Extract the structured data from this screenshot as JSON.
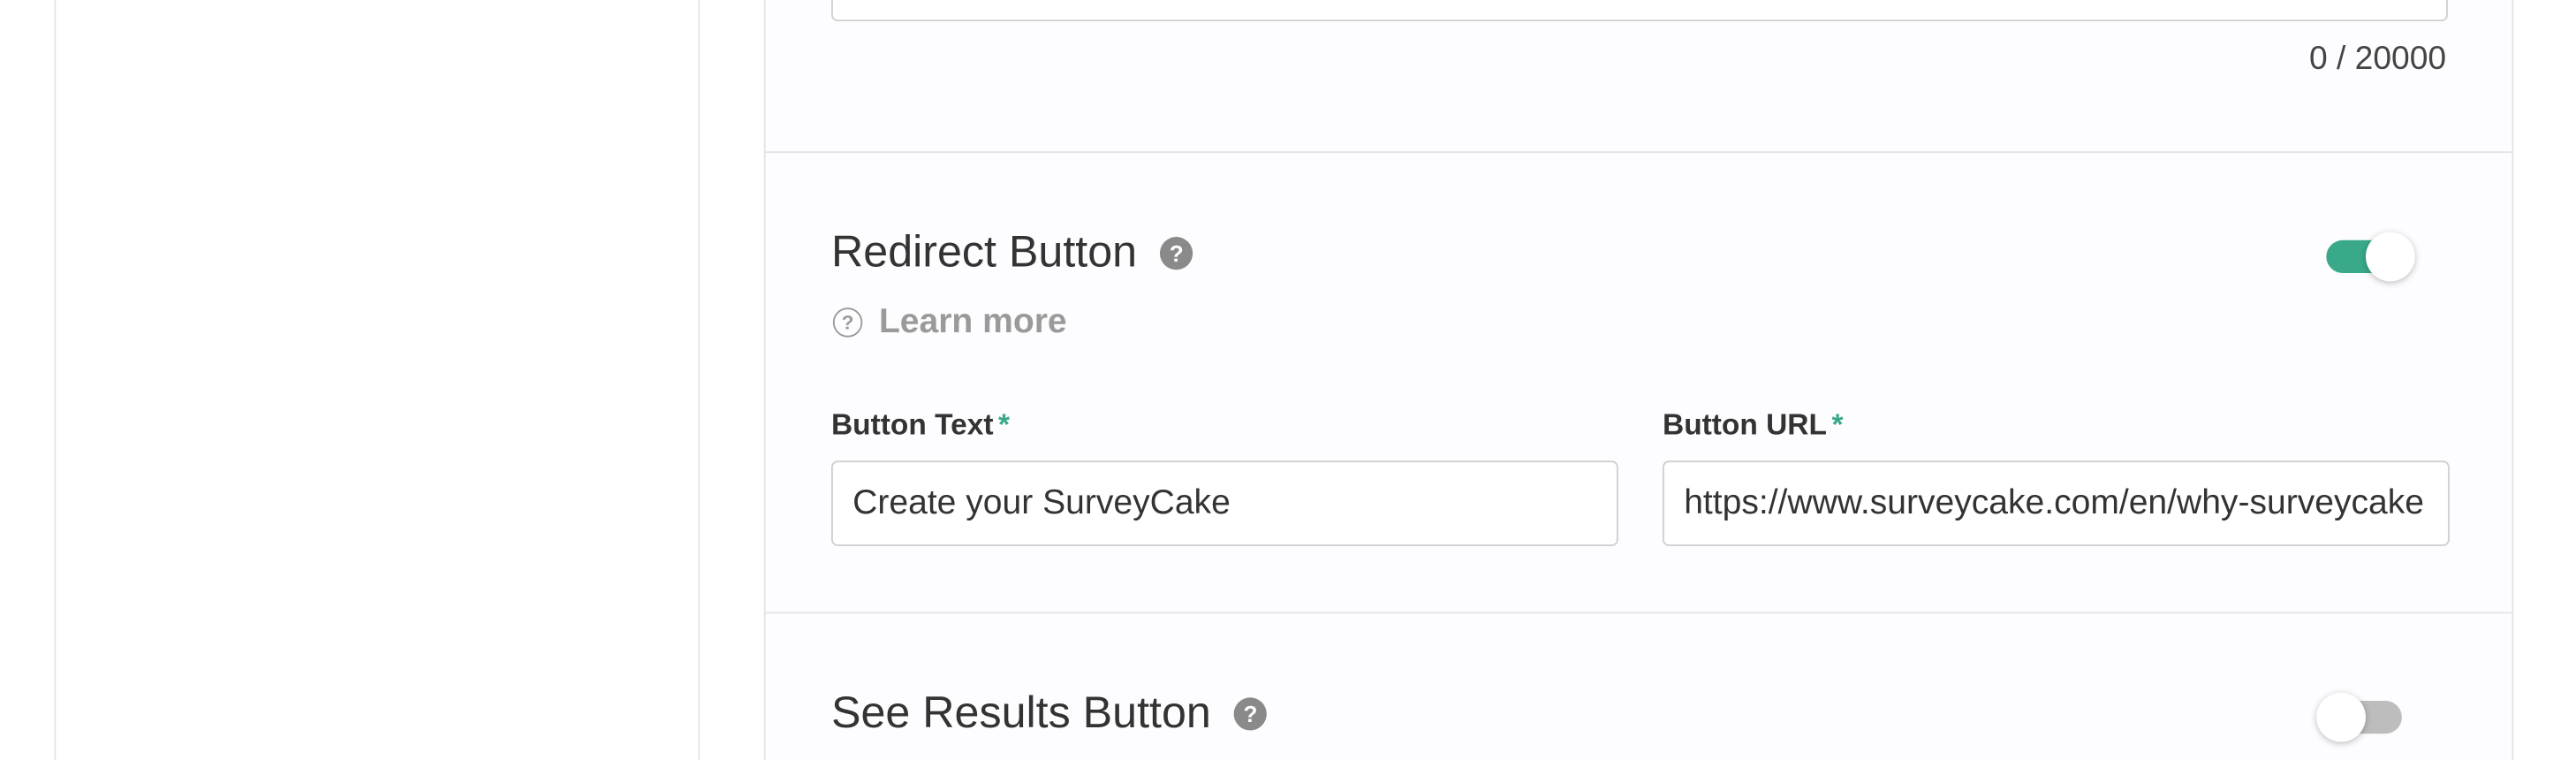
{
  "previous_field": {
    "char_counter": "0 / 20000"
  },
  "redirect_section": {
    "title": "Redirect Button",
    "help_icon": "question-circle-icon",
    "toggle_state": "on",
    "learn_more_label": "Learn more",
    "learn_more_icon": "question-outline-icon",
    "button_text": {
      "label": "Button Text",
      "required_mark": "*",
      "value": "Create your SurveyCake"
    },
    "button_url": {
      "label": "Button URL",
      "required_mark": "*",
      "value": "https://www.surveycake.com/en/why-surveycake"
    }
  },
  "results_section": {
    "title": "See Results Button",
    "help_icon": "question-circle-icon",
    "toggle_state": "off"
  },
  "colors": {
    "accent": "#39a98a",
    "toggle_off": "#bdbdbd",
    "help_icon": "#8a8a8a",
    "muted_text": "#9a9a9a"
  }
}
